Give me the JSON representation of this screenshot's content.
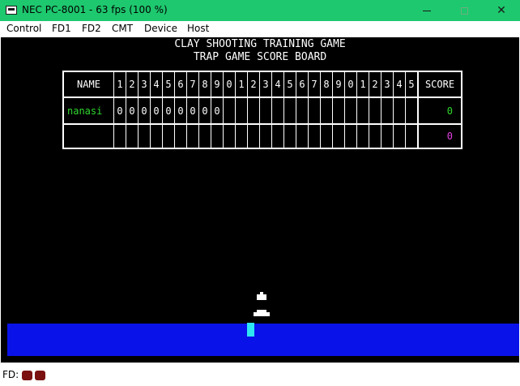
{
  "window": {
    "title": "NEC PC-8001 - 63 fps (100 %)",
    "buttons": {
      "minimize": "minimize-icon",
      "maximize": "maximize-icon",
      "close": "✕"
    }
  },
  "menu": [
    "Control",
    "FD1",
    "FD2",
    "CMT",
    "Device",
    "Host"
  ],
  "game": {
    "title_line1": "CLAY SHOOTING TRAINING GAME",
    "title_line2": "TRAP GAME SCORE BOARD",
    "name_header": "NAME",
    "score_header": "SCORE",
    "frame_numbers": [
      "1",
      "2",
      "3",
      "4",
      "5",
      "6",
      "7",
      "8",
      "9",
      "0",
      "1",
      "2",
      "3",
      "4",
      "5",
      "6",
      "7",
      "8",
      "9",
      "0",
      "1",
      "2",
      "3",
      "4",
      "5"
    ],
    "players": [
      {
        "name": "nanasi",
        "shots": [
          "0",
          "0",
          "0",
          "0",
          "0",
          "0",
          "0",
          "0",
          "0",
          "",
          "",
          "",
          "",
          "",
          "",
          "",
          "",
          "",
          "",
          "",
          "",
          "",
          "",
          "",
          ""
        ],
        "score": "0"
      },
      {
        "name": "",
        "shots": [
          "",
          "",
          "",
          "",
          "",
          "",
          "",
          "",
          "",
          "",
          "",
          "",
          "",
          "",
          "",
          "",
          "",
          "",
          "",
          "",
          "",
          "",
          "",
          "",
          ""
        ],
        "score": "0"
      }
    ]
  },
  "colors": {
    "titlebar": "#1ec86e",
    "screen_bg": "#000000",
    "player_name": "#2fd82f",
    "score_p1": "#2fd82f",
    "score_p2": "#e040e0",
    "ground": "#0a12ea",
    "shooter": "#2ee6f2",
    "fd_led": "#7a1010"
  },
  "status": {
    "fd_label": "FD:",
    "drive_leds": [
      "fd1-led",
      "fd2-led"
    ]
  }
}
